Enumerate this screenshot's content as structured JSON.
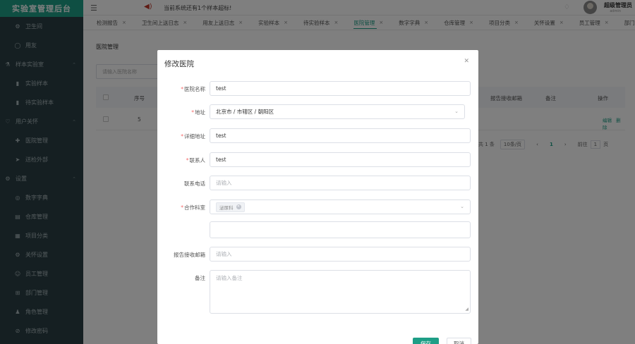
{
  "app": {
    "title": "实验室管理后台"
  },
  "sidebar": {
    "items": [
      {
        "label": "卫生间",
        "icon": "gear-icon",
        "level": "sub"
      },
      {
        "label": "用友",
        "icon": "circle-icon",
        "level": "sub"
      },
      {
        "label": "样本实验室",
        "icon": "flask-icon",
        "level": "top",
        "expanded": true
      },
      {
        "label": "实验样本",
        "icon": "vial-icon",
        "level": "sub"
      },
      {
        "label": "待实验样本",
        "icon": "vial-icon",
        "level": "sub"
      },
      {
        "label": "用户关怀",
        "icon": "heart-icon",
        "level": "top",
        "expanded": true
      },
      {
        "label": "医院管理",
        "icon": "hospital-icon",
        "level": "sub"
      },
      {
        "label": "送检外部",
        "icon": "send-icon",
        "level": "sub"
      },
      {
        "label": "设置",
        "icon": "gear-icon",
        "level": "top",
        "expanded": true
      },
      {
        "label": "数字字典",
        "icon": "dictionary-icon",
        "level": "sub"
      },
      {
        "label": "仓库管理",
        "icon": "warehouse-icon",
        "level": "sub"
      },
      {
        "label": "项目分类",
        "icon": "category-icon",
        "level": "sub"
      },
      {
        "label": "关怀设置",
        "icon": "settings-icon",
        "level": "sub"
      },
      {
        "label": "员工管理",
        "icon": "user-icon",
        "level": "sub"
      },
      {
        "label": "部门管理",
        "icon": "org-icon",
        "level": "sub"
      },
      {
        "label": "角色管理",
        "icon": "role-icon",
        "level": "sub"
      },
      {
        "label": "修改密码",
        "icon": "lock-icon",
        "level": "sub"
      }
    ]
  },
  "topbar": {
    "notice": "当前系统还有1个样本超标!",
    "user_name": "超级管理员",
    "user_sub": "admin"
  },
  "tabs": [
    {
      "label": "检测报告",
      "active": false
    },
    {
      "label": "卫生间上送日志",
      "active": false
    },
    {
      "label": "用友上送日志",
      "active": false
    },
    {
      "label": "实验样本",
      "active": false
    },
    {
      "label": "待实验样本",
      "active": false
    },
    {
      "label": "医院管理",
      "active": true
    },
    {
      "label": "数字字典",
      "active": false
    },
    {
      "label": "仓库管理",
      "active": false
    },
    {
      "label": "项目分类",
      "active": false
    },
    {
      "label": "关怀设置",
      "active": false
    },
    {
      "label": "员工管理",
      "active": false
    },
    {
      "label": "部门",
      "active": false
    }
  ],
  "main": {
    "page_title": "医院管理",
    "search_placeholder": "请输入医院名称",
    "columns": {
      "index": "序号",
      "report_email": "报告接收邮箱",
      "remark": "备注",
      "actions": "操作"
    },
    "rows": [
      {
        "index": "5",
        "edit_label": "编辑",
        "delete_label": "删除"
      }
    ],
    "pagination": {
      "total": "共 1 条",
      "page_size": "10条/页",
      "current_page": "1",
      "goto_label": "前往",
      "goto_value": "1",
      "page_suffix": "页"
    }
  },
  "dialog": {
    "title": "修改医院",
    "fields": {
      "hospital_name": {
        "label": "医院名称",
        "value": "test",
        "required": true
      },
      "region": {
        "label": "地址",
        "value": "北京市 / 市辖区 / 朝阳区",
        "required": true
      },
      "detail_address": {
        "label": "详细地址",
        "value": "test",
        "required": true
      },
      "contact": {
        "label": "联系人",
        "value": "test",
        "required": true
      },
      "phone": {
        "label": "联系电话",
        "placeholder": "请输入",
        "required": false
      },
      "department": {
        "label": "合作科室",
        "tag": "泌尿科",
        "required": true
      },
      "report_email": {
        "label": "报告接收邮箱",
        "placeholder": "请输入",
        "required": false
      },
      "remark": {
        "label": "备注",
        "placeholder": "请输入备注",
        "required": false
      }
    },
    "ok_label": "保存",
    "cancel_label": "取消"
  }
}
